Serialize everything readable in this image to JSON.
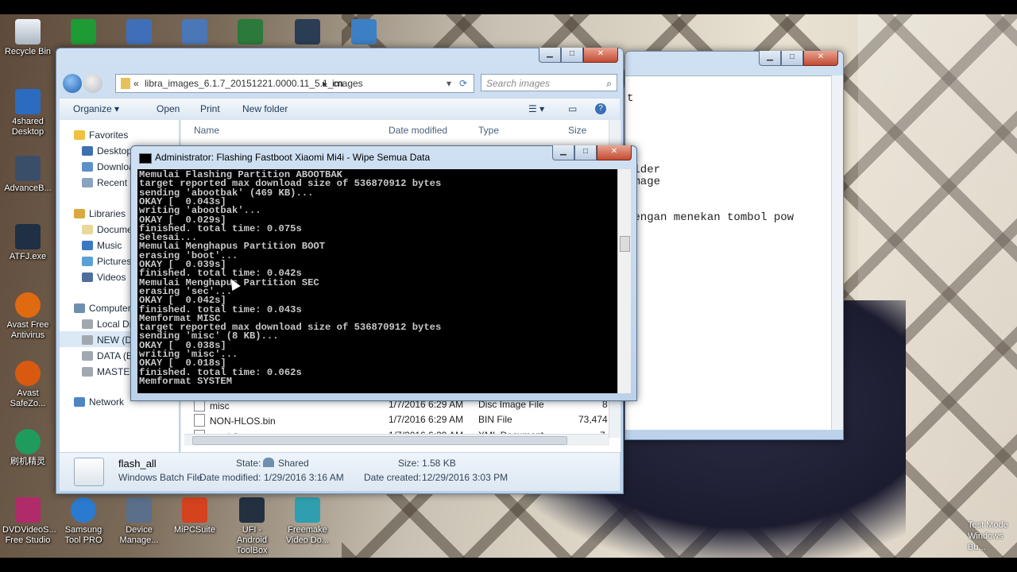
{
  "desktop": {
    "left_icons": [
      {
        "label": "Recycle Bin",
        "color": "#cfd8e0"
      },
      {
        "label": "4shared Desktop",
        "color": "#2b6cc0"
      },
      {
        "label": "AdvanceB...",
        "color": "#3a4e6a"
      },
      {
        "label": "ATFJ.exe",
        "color": "#1f2f44"
      },
      {
        "label": "Avast Free Antivirus",
        "color": "#e06a10"
      },
      {
        "label": "Avast SafeZo...",
        "color": "#d85a10"
      },
      {
        "label": "刷机精灵",
        "color": "#1f9b5e"
      },
      {
        "label": "DVDVideoS... Free Studio",
        "color": "#b02b6a"
      }
    ],
    "top_icons": [
      {
        "label": "",
        "color": "#1e9b35"
      },
      {
        "label": "",
        "color": "#3f6fb8"
      },
      {
        "label": "",
        "color": "#4b77b7"
      },
      {
        "label": "",
        "color": "#2b7a3b"
      },
      {
        "label": "",
        "color": "#2b3d55"
      },
      {
        "label": "",
        "color": "#3c7fc4"
      }
    ],
    "bottom_icons": [
      {
        "label": "Samsung Tool PRO",
        "color": "#2a7ad0"
      },
      {
        "label": "Device Manage...",
        "color": "#5a6f8a"
      },
      {
        "label": "MiPCSuite",
        "color": "#d4421f"
      },
      {
        "label": "UFI - Android ToolBox",
        "color": "#233040"
      },
      {
        "label": "Freemake Video Do...",
        "color": "#2f9fb0"
      }
    ],
    "watermark": [
      "Test Mode",
      "Windows",
      "Bu..."
    ]
  },
  "back_window": {
    "lines": [
      "t",
      "older",
      "image",
      "dengan menekan tombol pow"
    ]
  },
  "explorer": {
    "breadcrumb": [
      "«",
      "libra_images_6.1.7_20151221.0000.11_5.1_cn",
      "▸",
      "images"
    ],
    "search_placeholder": "Search images",
    "toolbar": {
      "organize": "Organize ▾",
      "open": "Open",
      "print": "Print",
      "new_folder": "New folder"
    },
    "nav": {
      "favorites": "Favorites",
      "fav_items": [
        "Desktop",
        "Downloads",
        "Recent Places"
      ],
      "libraries": "Libraries",
      "lib_items": [
        "Documents",
        "Music",
        "Pictures",
        "Videos"
      ],
      "computer": "Computer",
      "drives": [
        "Local Disk (C:)",
        "NEW (D:)",
        "DATA (E:)",
        "MASTER"
      ],
      "network": "Network"
    },
    "columns": {
      "name": "Name",
      "date": "Date modified",
      "type": "Type",
      "size": "Size"
    },
    "files": [
      {
        "name": "misc",
        "date": "1/7/2016 6:29 AM",
        "type": "Disc Image File",
        "size": "8"
      },
      {
        "name": "NON-HLOS.bin",
        "date": "1/7/2016 6:29 AM",
        "type": "BIN File",
        "size": "73,474"
      },
      {
        "name": "patch0",
        "date": "1/7/2016 6:29 AM",
        "type": "XML Document",
        "size": "7"
      }
    ],
    "details": {
      "name": "flash_all",
      "kind": "Windows Batch File",
      "state_label": "State:",
      "state": "Shared",
      "size_label": "Size:",
      "size": "1.58 KB",
      "modified_label": "Date modified:",
      "modified": "1/29/2016 3:16 AM",
      "created_label": "Date created:",
      "created": "12/29/2016 3:03 PM"
    }
  },
  "console": {
    "title": "Administrator:  Flashing Fastboot Xiaomi Mi4i - Wipe Semua Data",
    "lines": [
      "Memulai Flashing Partition ABOOTBAK",
      "target reported max download size of 536870912 bytes",
      "sending 'abootbak' (469 KB)...",
      "OKAY [  0.043s]",
      "writing 'abootbak'...",
      "OKAY [  0.029s]",
      "finished. total time: 0.075s",
      "Selesai...",
      "Memulai Menghapus Partition BOOT",
      "erasing 'boot'...",
      "OKAY [  0.039s]",
      "finished. total time: 0.042s",
      "Memulai Menghapus Partition SEC",
      "erasing 'sec'...",
      "OKAY [  0.042s]",
      "finished. total time: 0.043s",
      "Memformat MISC",
      "target reported max download size of 536870912 bytes",
      "sending 'misc' (8 KB)...",
      "OKAY [  0.038s]",
      "writing 'misc'...",
      "OKAY [  0.018s]",
      "finished. total time: 0.062s",
      "Memformat SYSTEM"
    ]
  }
}
